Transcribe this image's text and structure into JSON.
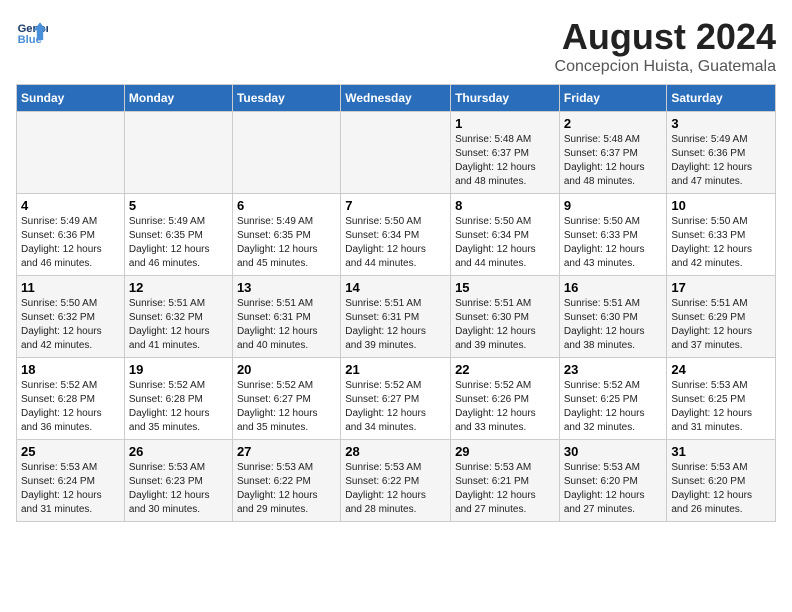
{
  "header": {
    "logo_line1": "General",
    "logo_line2": "Blue",
    "title": "August 2024",
    "subtitle": "Concepcion Huista, Guatemala"
  },
  "weekdays": [
    "Sunday",
    "Monday",
    "Tuesday",
    "Wednesday",
    "Thursday",
    "Friday",
    "Saturday"
  ],
  "weeks": [
    [
      {
        "day": "",
        "info": ""
      },
      {
        "day": "",
        "info": ""
      },
      {
        "day": "",
        "info": ""
      },
      {
        "day": "",
        "info": ""
      },
      {
        "day": "1",
        "info": "Sunrise: 5:48 AM\nSunset: 6:37 PM\nDaylight: 12 hours\nand 48 minutes."
      },
      {
        "day": "2",
        "info": "Sunrise: 5:48 AM\nSunset: 6:37 PM\nDaylight: 12 hours\nand 48 minutes."
      },
      {
        "day": "3",
        "info": "Sunrise: 5:49 AM\nSunset: 6:36 PM\nDaylight: 12 hours\nand 47 minutes."
      }
    ],
    [
      {
        "day": "4",
        "info": "Sunrise: 5:49 AM\nSunset: 6:36 PM\nDaylight: 12 hours\nand 46 minutes."
      },
      {
        "day": "5",
        "info": "Sunrise: 5:49 AM\nSunset: 6:35 PM\nDaylight: 12 hours\nand 46 minutes."
      },
      {
        "day": "6",
        "info": "Sunrise: 5:49 AM\nSunset: 6:35 PM\nDaylight: 12 hours\nand 45 minutes."
      },
      {
        "day": "7",
        "info": "Sunrise: 5:50 AM\nSunset: 6:34 PM\nDaylight: 12 hours\nand 44 minutes."
      },
      {
        "day": "8",
        "info": "Sunrise: 5:50 AM\nSunset: 6:34 PM\nDaylight: 12 hours\nand 44 minutes."
      },
      {
        "day": "9",
        "info": "Sunrise: 5:50 AM\nSunset: 6:33 PM\nDaylight: 12 hours\nand 43 minutes."
      },
      {
        "day": "10",
        "info": "Sunrise: 5:50 AM\nSunset: 6:33 PM\nDaylight: 12 hours\nand 42 minutes."
      }
    ],
    [
      {
        "day": "11",
        "info": "Sunrise: 5:50 AM\nSunset: 6:32 PM\nDaylight: 12 hours\nand 42 minutes."
      },
      {
        "day": "12",
        "info": "Sunrise: 5:51 AM\nSunset: 6:32 PM\nDaylight: 12 hours\nand 41 minutes."
      },
      {
        "day": "13",
        "info": "Sunrise: 5:51 AM\nSunset: 6:31 PM\nDaylight: 12 hours\nand 40 minutes."
      },
      {
        "day": "14",
        "info": "Sunrise: 5:51 AM\nSunset: 6:31 PM\nDaylight: 12 hours\nand 39 minutes."
      },
      {
        "day": "15",
        "info": "Sunrise: 5:51 AM\nSunset: 6:30 PM\nDaylight: 12 hours\nand 39 minutes."
      },
      {
        "day": "16",
        "info": "Sunrise: 5:51 AM\nSunset: 6:30 PM\nDaylight: 12 hours\nand 38 minutes."
      },
      {
        "day": "17",
        "info": "Sunrise: 5:51 AM\nSunset: 6:29 PM\nDaylight: 12 hours\nand 37 minutes."
      }
    ],
    [
      {
        "day": "18",
        "info": "Sunrise: 5:52 AM\nSunset: 6:28 PM\nDaylight: 12 hours\nand 36 minutes."
      },
      {
        "day": "19",
        "info": "Sunrise: 5:52 AM\nSunset: 6:28 PM\nDaylight: 12 hours\nand 35 minutes."
      },
      {
        "day": "20",
        "info": "Sunrise: 5:52 AM\nSunset: 6:27 PM\nDaylight: 12 hours\nand 35 minutes."
      },
      {
        "day": "21",
        "info": "Sunrise: 5:52 AM\nSunset: 6:27 PM\nDaylight: 12 hours\nand 34 minutes."
      },
      {
        "day": "22",
        "info": "Sunrise: 5:52 AM\nSunset: 6:26 PM\nDaylight: 12 hours\nand 33 minutes."
      },
      {
        "day": "23",
        "info": "Sunrise: 5:52 AM\nSunset: 6:25 PM\nDaylight: 12 hours\nand 32 minutes."
      },
      {
        "day": "24",
        "info": "Sunrise: 5:53 AM\nSunset: 6:25 PM\nDaylight: 12 hours\nand 31 minutes."
      }
    ],
    [
      {
        "day": "25",
        "info": "Sunrise: 5:53 AM\nSunset: 6:24 PM\nDaylight: 12 hours\nand 31 minutes."
      },
      {
        "day": "26",
        "info": "Sunrise: 5:53 AM\nSunset: 6:23 PM\nDaylight: 12 hours\nand 30 minutes."
      },
      {
        "day": "27",
        "info": "Sunrise: 5:53 AM\nSunset: 6:22 PM\nDaylight: 12 hours\nand 29 minutes."
      },
      {
        "day": "28",
        "info": "Sunrise: 5:53 AM\nSunset: 6:22 PM\nDaylight: 12 hours\nand 28 minutes."
      },
      {
        "day": "29",
        "info": "Sunrise: 5:53 AM\nSunset: 6:21 PM\nDaylight: 12 hours\nand 27 minutes."
      },
      {
        "day": "30",
        "info": "Sunrise: 5:53 AM\nSunset: 6:20 PM\nDaylight: 12 hours\nand 27 minutes."
      },
      {
        "day": "31",
        "info": "Sunrise: 5:53 AM\nSunset: 6:20 PM\nDaylight: 12 hours\nand 26 minutes."
      }
    ]
  ]
}
